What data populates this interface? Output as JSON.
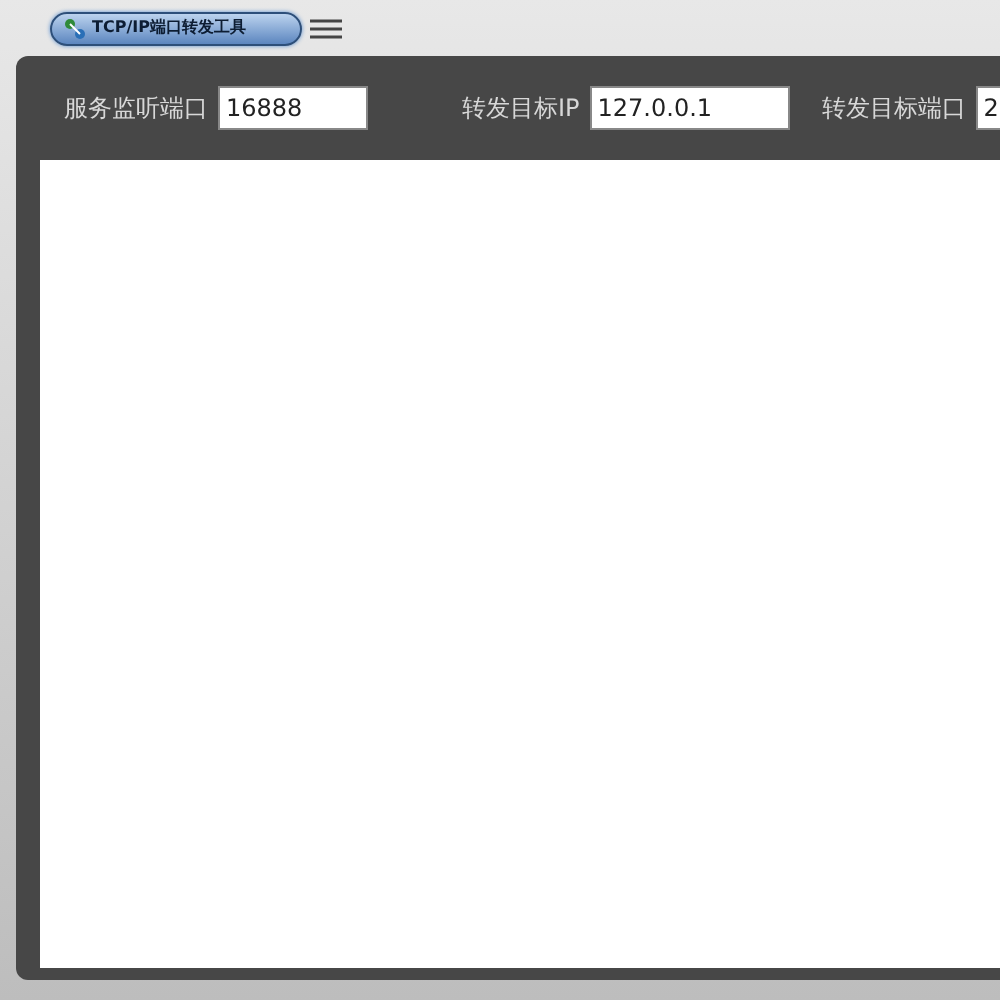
{
  "window": {
    "title": "TCP/IP端口转发工具"
  },
  "fields": [
    {
      "label": "服务监听端口",
      "value": "16888"
    },
    {
      "label": "转发目标IP",
      "value": "127.0.0.1"
    },
    {
      "label": "转发目标端口",
      "value": "2"
    }
  ]
}
